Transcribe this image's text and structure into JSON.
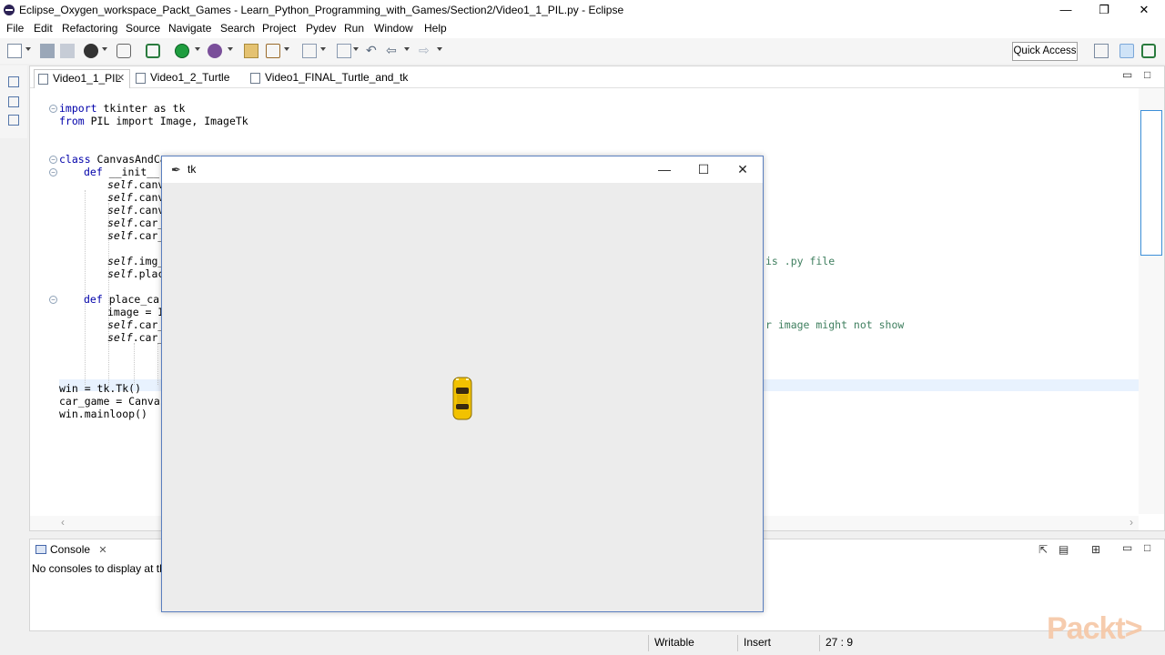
{
  "window": {
    "title": "Eclipse_Oxygen_workspace_Packt_Games - Learn_Python_Programming_with_Games/Section2/Video1_1_PIL.py - Eclipse",
    "minimize": "—",
    "maximize": "❐",
    "close": "✕"
  },
  "menu": [
    "File",
    "Edit",
    "Refactoring",
    "Source",
    "Navigate",
    "Search",
    "Project",
    "Pydev",
    "Run",
    "Window",
    "Help"
  ],
  "toolbar": {
    "quick_access": "Quick Access"
  },
  "editor": {
    "tabs": [
      {
        "label": "Video1_1_PIL",
        "active": true
      },
      {
        "label": "Video1_2_Turtle",
        "active": false
      },
      {
        "label": "Video1_FINAL_Turtle_and_tk",
        "active": false
      }
    ],
    "code_lines": [
      {
        "kw": "import",
        "rest": " tkinter as tk"
      },
      {
        "kw": "from",
        "rest": " PIL import Image, ImageTk"
      },
      {
        "kw": "class",
        "rest": " CanvasAndCar"
      },
      {
        "kw": "def",
        "rest": " __init__("
      },
      {
        "self": "self",
        "rest": ".canv"
      },
      {
        "self": "self",
        "rest": ".canv"
      },
      {
        "self": "self",
        "rest": ".canv"
      },
      {
        "self": "self",
        "rest": ".car_"
      },
      {
        "self": "self",
        "rest": ".car_"
      },
      {
        "self": "self",
        "rest": ".img_"
      },
      {
        "self": "self",
        "rest": ".plac"
      },
      {
        "kw": "def",
        "rest": " place_car"
      },
      {
        "kw": "",
        "rest": "image = I"
      },
      {
        "self": "self",
        "rest": ".car_"
      },
      {
        "self": "self",
        "rest": ".car_"
      },
      {
        "kw": "",
        "rest": "win = tk.Tk()"
      },
      {
        "kw": "",
        "rest": "car_game = Canvas"
      },
      {
        "kw": "",
        "rest": "win.mainloop()"
      }
    ],
    "comment_1": "is .py file",
    "comment_2": "r image might not show"
  },
  "console": {
    "tab_label": "Console",
    "message": "No consoles to display at this"
  },
  "statusbar": {
    "mode": "Writable",
    "insert": "Insert",
    "position": "27 : 9"
  },
  "tk_window": {
    "title": "tk",
    "minimize": "—",
    "maximize": "☐",
    "close": "✕"
  },
  "watermark": "Packt>",
  "colors": {
    "accent": "#3c8fd8",
    "keyword": "#0000aa",
    "car": "#f2c200"
  }
}
